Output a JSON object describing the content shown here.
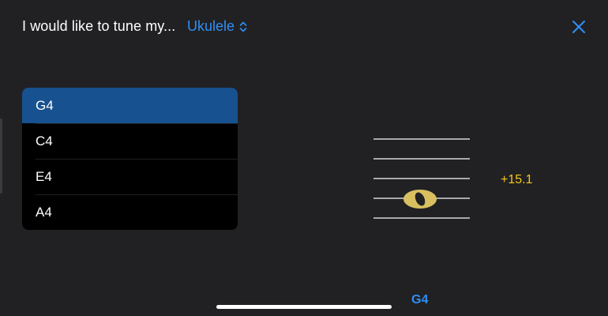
{
  "header": {
    "prompt": "I would like to tune my...",
    "instrument": "Ukulele",
    "chevron_icon": "chevron-up-down-icon",
    "close_icon": "close-icon"
  },
  "strings": {
    "items": [
      {
        "label": "G4",
        "selected": true
      },
      {
        "label": "C4",
        "selected": false
      },
      {
        "label": "E4",
        "selected": false
      },
      {
        "label": "A4",
        "selected": false
      }
    ]
  },
  "tuner": {
    "staff_icon": "music-staff-icon",
    "note_icon": "whole-note-icon",
    "cents_offset": "+15.1",
    "detected_note": "G4"
  },
  "colors": {
    "background": "#212124",
    "accent": "#2f8ff5",
    "selected_row": "#17518f",
    "note_gold": "#d8c060",
    "cents": "#f5c718"
  }
}
